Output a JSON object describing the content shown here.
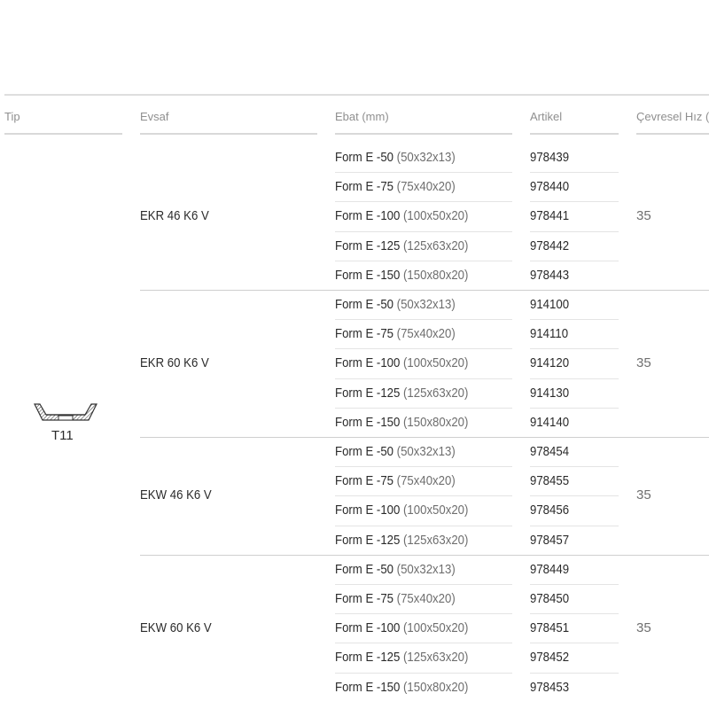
{
  "headers": {
    "tip": "Tip",
    "evsaf": "Evsaf",
    "ebat": "Ebat (mm)",
    "artikel": "Artikel",
    "hiz": "Çevresel Hız ("
  },
  "type": {
    "label": "T11",
    "icon": "cup-wheel-icon"
  },
  "groups": [
    {
      "evsaf": "EKR 46 K6 V",
      "speed": "35",
      "rows": [
        {
          "form": "Form E  -50",
          "dim": "(50x32x13)",
          "artikel": "978439"
        },
        {
          "form": "Form E  -75",
          "dim": "(75x40x20)",
          "artikel": "978440"
        },
        {
          "form": "Form E  -100",
          "dim": "(100x50x20)",
          "artikel": "978441"
        },
        {
          "form": "Form E  -125",
          "dim": "(125x63x20)",
          "artikel": "978442"
        },
        {
          "form": "Form E  -150",
          "dim": "(150x80x20)",
          "artikel": "978443"
        }
      ]
    },
    {
      "evsaf": "EKR 60 K6 V",
      "speed": "35",
      "rows": [
        {
          "form": "Form E  -50",
          "dim": "(50x32x13)",
          "artikel": "914100"
        },
        {
          "form": "Form E  -75",
          "dim": "(75x40x20)",
          "artikel": "914110"
        },
        {
          "form": "Form E  -100",
          "dim": "(100x50x20)",
          "artikel": "914120"
        },
        {
          "form": "Form E  -125",
          "dim": "(125x63x20)",
          "artikel": "914130"
        },
        {
          "form": "Form E  -150",
          "dim": "(150x80x20)",
          "artikel": "914140"
        }
      ]
    },
    {
      "evsaf": "EKW 46 K6 V",
      "speed": "35",
      "rows": [
        {
          "form": "Form E  -50",
          "dim": "(50x32x13)",
          "artikel": "978454"
        },
        {
          "form": "Form E  -75",
          "dim": "(75x40x20)",
          "artikel": "978455"
        },
        {
          "form": "Form E  -100",
          "dim": "(100x50x20)",
          "artikel": "978456"
        },
        {
          "form": "Form E  -125",
          "dim": "(125x63x20)",
          "artikel": "978457"
        }
      ]
    },
    {
      "evsaf": "EKW 60 K6 V",
      "speed": "35",
      "rows": [
        {
          "form": "Form E  -50",
          "dim": "(50x32x13)",
          "artikel": "978449"
        },
        {
          "form": "Form E  -75",
          "dim": "(75x40x20)",
          "artikel": "978450"
        },
        {
          "form": "Form E  -100",
          "dim": "(100x50x20)",
          "artikel": "978451"
        },
        {
          "form": "Form E  -125",
          "dim": "(125x63x20)",
          "artikel": "978452"
        },
        {
          "form": "Form E  -150",
          "dim": "(150x80x20)",
          "artikel": "978453"
        }
      ]
    }
  ]
}
